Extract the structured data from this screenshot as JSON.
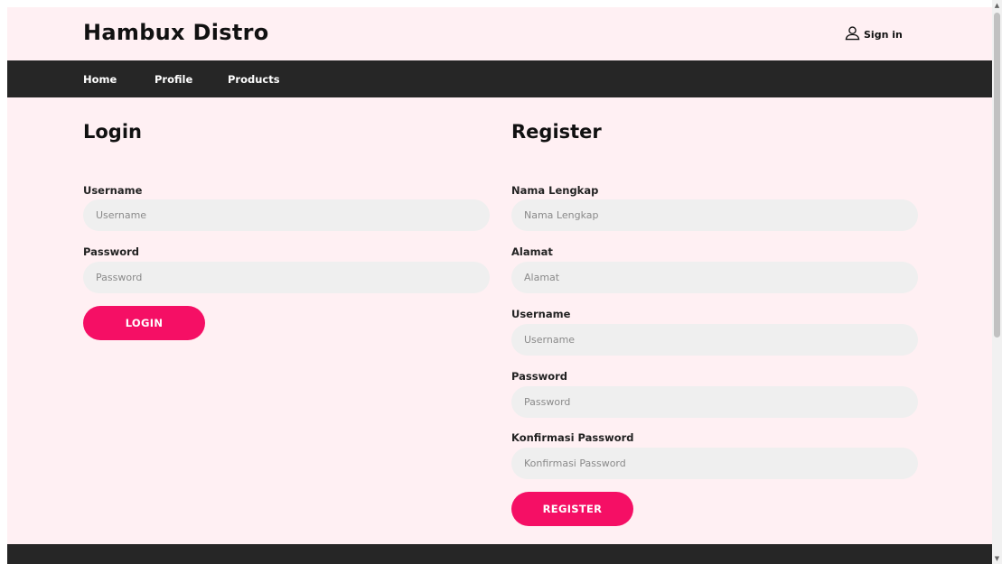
{
  "header": {
    "brand": "Hambux Distro",
    "signin_label": "Sign in",
    "signin_icon": "user-icon"
  },
  "nav": {
    "items": [
      {
        "label": "Home"
      },
      {
        "label": "Profile"
      },
      {
        "label": "Products"
      }
    ]
  },
  "login": {
    "title": "Login",
    "fields": [
      {
        "label": "Username",
        "placeholder": "Username",
        "value": ""
      },
      {
        "label": "Password",
        "placeholder": "Password",
        "value": ""
      }
    ],
    "button_label": "LOGIN"
  },
  "register": {
    "title": "Register",
    "fields": [
      {
        "label": "Nama Lengkap",
        "placeholder": "Nama Lengkap",
        "value": ""
      },
      {
        "label": "Alamat",
        "placeholder": "Alamat",
        "value": ""
      },
      {
        "label": "Username",
        "placeholder": "Username",
        "value": ""
      },
      {
        "label": "Password",
        "placeholder": "Password",
        "value": ""
      },
      {
        "label": "Konfirmasi Password",
        "placeholder": "Konfirmasi Password",
        "value": ""
      }
    ],
    "button_label": "REGISTER"
  },
  "colors": {
    "page_background": "#fff0f3",
    "nav_background": "#262626",
    "accent": "#f50f65",
    "input_background": "#efefef"
  }
}
